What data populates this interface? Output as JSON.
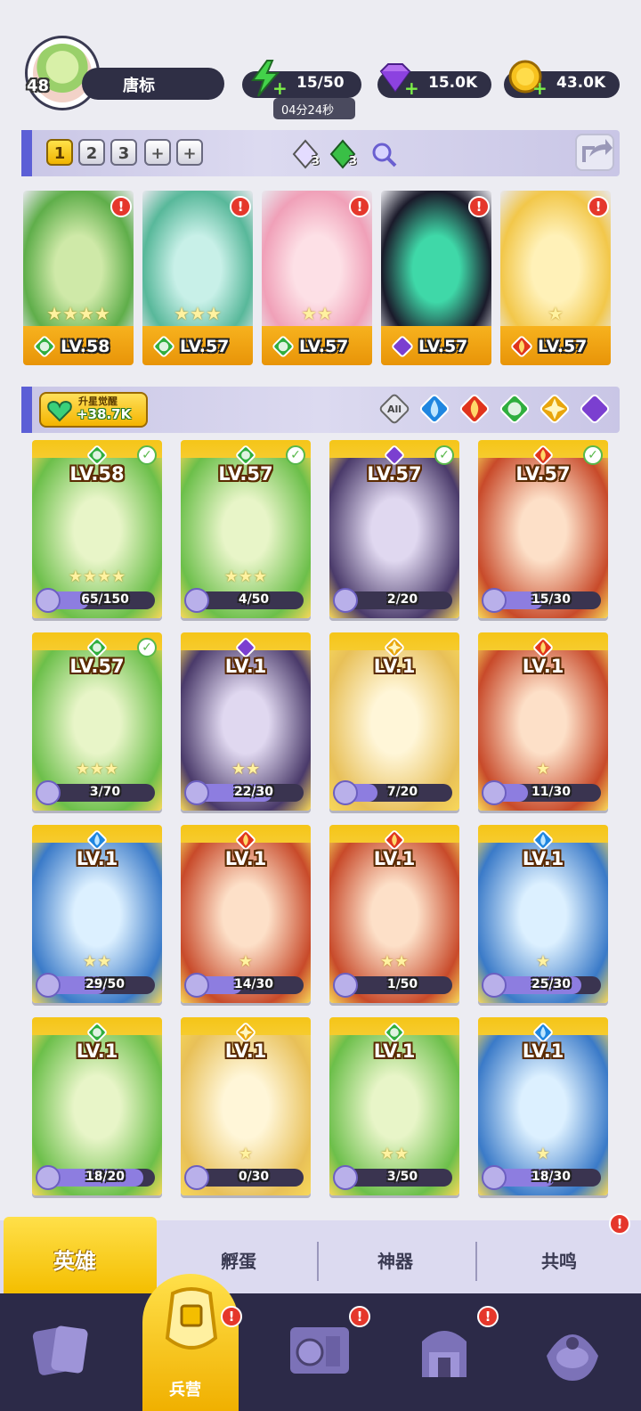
{
  "player": {
    "level": "48",
    "name": "唐标"
  },
  "resources": {
    "energy": {
      "value": "15/50",
      "timer": "04分24秒"
    },
    "gems": {
      "value": "15.0K"
    },
    "coins": {
      "value": "43.0K"
    }
  },
  "team": {
    "slots": [
      "1",
      "2",
      "3",
      "+",
      "+"
    ],
    "active": "1",
    "gem_counts": [
      "3",
      "3"
    ]
  },
  "featured": [
    {
      "level": "LV.58",
      "stars": "★★★★",
      "element": "nature",
      "alert": "!"
    },
    {
      "level": "LV.57",
      "stars": "★★★",
      "element": "nature",
      "alert": "!"
    },
    {
      "level": "LV.57",
      "stars": "★★",
      "element": "nature",
      "alert": "!"
    },
    {
      "level": "LV.57",
      "stars": "",
      "element": "dark",
      "alert": "!"
    },
    {
      "level": "LV.57",
      "stars": "★",
      "element": "fire",
      "alert": "!"
    }
  ],
  "awaken": {
    "label": "升星觉醒",
    "value": "+38.7K"
  },
  "filters": [
    "All",
    "water",
    "fire",
    "nature",
    "light",
    "dark"
  ],
  "heroes": [
    {
      "level": "LV.58",
      "fragments": "65/150",
      "progress": 0.43,
      "element": "nature",
      "checked": true
    },
    {
      "level": "LV.57",
      "fragments": "4/50",
      "progress": 0.08,
      "element": "nature",
      "checked": true
    },
    {
      "level": "LV.57",
      "fragments": "2/20",
      "progress": 0.1,
      "element": "dark",
      "checked": true
    },
    {
      "level": "LV.57",
      "fragments": "15/30",
      "progress": 0.5,
      "element": "fire",
      "checked": true
    },
    {
      "level": "LV.57",
      "fragments": "3/70",
      "progress": 0.04,
      "element": "nature",
      "checked": true
    },
    {
      "level": "LV.1",
      "fragments": "22/30",
      "progress": 0.73,
      "element": "dark",
      "checked": false
    },
    {
      "level": "LV.1",
      "fragments": "7/20",
      "progress": 0.35,
      "element": "light",
      "checked": false
    },
    {
      "level": "LV.1",
      "fragments": "11/30",
      "progress": 0.37,
      "element": "fire",
      "checked": false
    },
    {
      "level": "LV.1",
      "fragments": "29/50",
      "progress": 0.58,
      "element": "water",
      "checked": false
    },
    {
      "level": "LV.1",
      "fragments": "14/30",
      "progress": 0.47,
      "element": "fire",
      "checked": false
    },
    {
      "level": "LV.1",
      "fragments": "1/50",
      "progress": 0.02,
      "element": "fire",
      "checked": false
    },
    {
      "level": "LV.1",
      "fragments": "25/30",
      "progress": 0.83,
      "element": "water",
      "checked": false
    },
    {
      "level": "LV.1",
      "fragments": "18/20",
      "progress": 0.9,
      "element": "nature",
      "checked": false
    },
    {
      "level": "LV.1",
      "fragments": "0/30",
      "progress": 0.0,
      "element": "light",
      "checked": false
    },
    {
      "level": "LV.1",
      "fragments": "3/50",
      "progress": 0.06,
      "element": "nature",
      "checked": false
    },
    {
      "level": "LV.1",
      "fragments": "18/30",
      "progress": 0.6,
      "element": "water",
      "checked": false
    }
  ],
  "subtabs": [
    "英雄",
    "孵蛋",
    "神器",
    "共鸣"
  ],
  "bottom_nav": {
    "active_label": "兵营"
  },
  "colors": {
    "nature": "#2fae3e",
    "dark": "#7b3fd0",
    "fire": "#e0341c",
    "water": "#1f86e0",
    "light": "#e8a50c",
    "accent": "#f4be00"
  }
}
